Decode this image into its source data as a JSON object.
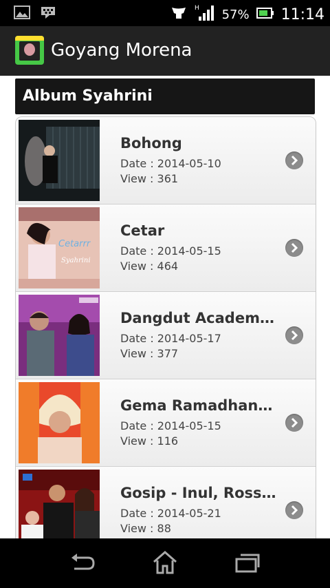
{
  "status_bar": {
    "battery_percent": "57%",
    "time": "11:14",
    "network_badge": "H",
    "icons": [
      "gallery-icon",
      "bbm-icon",
      "vibrate-icon",
      "signal-icon",
      "battery-icon"
    ]
  },
  "action_bar": {
    "title": "Goyang Morena",
    "icon": "app-icon"
  },
  "section": {
    "title": "Album Syahrini"
  },
  "items": [
    {
      "title": "Bohong",
      "date": "Date : 2014-05-10",
      "view": "View : 361"
    },
    {
      "title": "Cetar",
      "date": "Date : 2014-05-15",
      "view": "View : 464"
    },
    {
      "title": "Dangdut Academy ...",
      "date": "Date : 2014-05-17",
      "view": "View : 377"
    },
    {
      "title": "Gema Ramadhan 2...",
      "date": "Date : 2014-05-15",
      "view": "View : 116"
    },
    {
      "title": "Gosip - Inul, Rossa...",
      "date": "Date : 2014-05-21",
      "view": "View : 88"
    }
  ],
  "nav_bar": {
    "buttons": [
      "back-icon",
      "home-icon",
      "recent-apps-icon"
    ]
  },
  "colors": {
    "status_bar_bg": "#000000",
    "action_bar_bg": "#222222",
    "section_header_bg": "#161616",
    "arrow": "#8c8c8c"
  }
}
